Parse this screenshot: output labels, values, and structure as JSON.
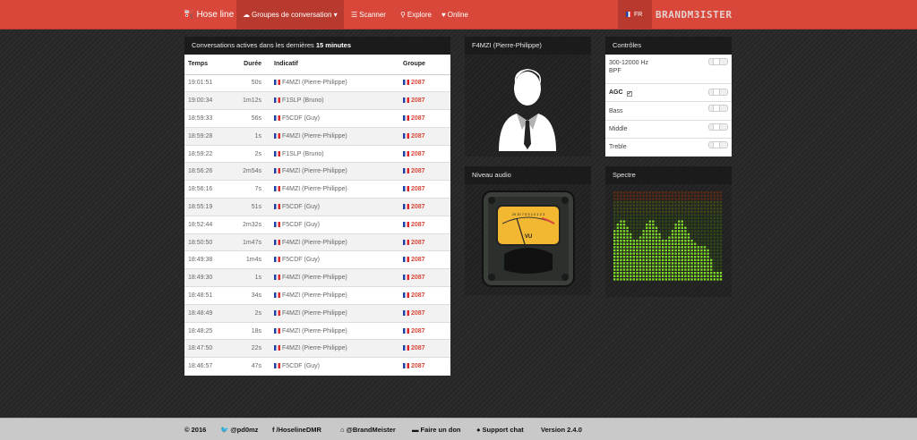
{
  "nav": {
    "brand": "Hose line",
    "items": [
      {
        "label": "Groupes de conversation",
        "icon": "cloud-icon",
        "caret": "▾"
      },
      {
        "label": "Scanner",
        "icon": "list-icon"
      },
      {
        "label": "Explore",
        "icon": "map-pin-icon"
      },
      {
        "label": "Online",
        "icon": "heart-icon"
      }
    ],
    "lang": "FR",
    "logo": "BRANDM3ISTER"
  },
  "conversations": {
    "header_prefix": "Conversations actives dans les dernières",
    "header_bold": "15 minutes",
    "columns": [
      "Temps",
      "Durée",
      "Indicatif",
      "Groupe"
    ],
    "rows": [
      {
        "time": "19:01:51",
        "dur": "50s",
        "call": "F4MZI (Pierre-Philippe)",
        "group": "2087"
      },
      {
        "time": "19:00:34",
        "dur": "1m12s",
        "call": "F1SLP (Bruno)",
        "group": "2087"
      },
      {
        "time": "18:59:33",
        "dur": "56s",
        "call": "F5CDF (Guy)",
        "group": "2087"
      },
      {
        "time": "18:59:28",
        "dur": "1s",
        "call": "F4MZI (Pierre-Philippe)",
        "group": "2087"
      },
      {
        "time": "18:59:22",
        "dur": "2s",
        "call": "F1SLP (Bruno)",
        "group": "2087"
      },
      {
        "time": "18:56:26",
        "dur": "2m54s",
        "call": "F4MZI (Pierre-Philippe)",
        "group": "2087"
      },
      {
        "time": "18:56:16",
        "dur": "7s",
        "call": "F4MZI (Pierre-Philippe)",
        "group": "2087"
      },
      {
        "time": "18:55:19",
        "dur": "51s",
        "call": "F5CDF (Guy)",
        "group": "2087"
      },
      {
        "time": "18:52:44",
        "dur": "2m32s",
        "call": "F5CDF (Guy)",
        "group": "2087"
      },
      {
        "time": "18:50:50",
        "dur": "1m47s",
        "call": "F4MZI (Pierre-Philippe)",
        "group": "2087"
      },
      {
        "time": "18:49:38",
        "dur": "1m4s",
        "call": "F5CDF (Guy)",
        "group": "2087"
      },
      {
        "time": "18:49:30",
        "dur": "1s",
        "call": "F4MZI (Pierre-Philippe)",
        "group": "2087"
      },
      {
        "time": "18:48:51",
        "dur": "34s",
        "call": "F4MZI (Pierre-Philippe)",
        "group": "2087"
      },
      {
        "time": "18:48:49",
        "dur": "2s",
        "call": "F4MZI (Pierre-Philippe)",
        "group": "2087"
      },
      {
        "time": "18:48:25",
        "dur": "18s",
        "call": "F4MZI (Pierre-Philippe)",
        "group": "2087"
      },
      {
        "time": "18:47:50",
        "dur": "22s",
        "call": "F4MZI (Pierre-Philippe)",
        "group": "2087"
      },
      {
        "time": "18:46:57",
        "dur": "47s",
        "call": "F5CDF (Guy)",
        "group": "2087"
      }
    ]
  },
  "profile": {
    "title": "F4MZI (Pierre-Philippe)"
  },
  "controls": {
    "title": "Contrôles",
    "rows": [
      {
        "label": "300-12000 Hz",
        "label2": "BPF"
      },
      {
        "label": "AGC",
        "checked": true
      },
      {
        "label": "Bass"
      },
      {
        "label": "Middle"
      },
      {
        "label": "Treble"
      }
    ]
  },
  "audio": {
    "title": "Niveau audio",
    "vu_label": "VU",
    "scale": "20 10 7 5 3 1 0 1 2 3"
  },
  "spectrum": {
    "title": "Spectre"
  },
  "footer": {
    "copyright": "© 2016",
    "twitter": "@pd0mz",
    "facebook": "/HoselineDMR",
    "brandmeister": "@BrandMeister",
    "donate": "Faire un don",
    "support": "Support chat",
    "version": "Version 2.4.0"
  },
  "colors": {
    "accent": "#d8473a",
    "accent_dark": "#b83a2f"
  }
}
